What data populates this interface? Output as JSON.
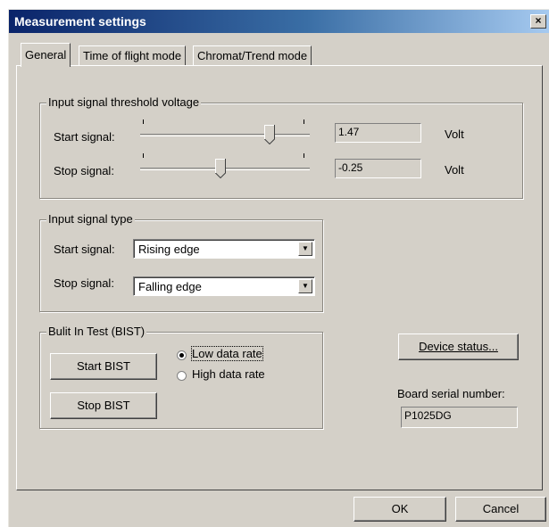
{
  "window": {
    "title": "Measurement settings",
    "close_glyph": "×"
  },
  "tabs": [
    {
      "label": "General",
      "active": true
    },
    {
      "label": "Time of flight mode",
      "active": false
    },
    {
      "label": "Chromat/Trend mode",
      "active": false
    }
  ],
  "threshold": {
    "legend": "Input signal threshold voltage",
    "start": {
      "label": "Start signal:",
      "value": "1.47",
      "unit": "Volt",
      "level": 0.78
    },
    "stop": {
      "label": "Stop signal:",
      "value": "-0.25",
      "unit": "Volt",
      "level": 0.47
    }
  },
  "signal_type": {
    "legend": "Input signal type",
    "start": {
      "label": "Start signal:",
      "value": "Rising edge"
    },
    "stop": {
      "label": "Stop signal:",
      "value": "Falling edge"
    }
  },
  "bist": {
    "legend": "Bulit In Test (BIST)",
    "start_button": "Start BIST",
    "stop_button": "Stop BIST",
    "low_rate": "Low data rate",
    "high_rate": "High data rate",
    "selected": "low"
  },
  "device": {
    "status_button": "Device status...",
    "serial_label": "Board serial number:",
    "serial_value": "P1025DG"
  },
  "footer": {
    "ok": "OK",
    "cancel": "Cancel"
  },
  "icons": {
    "dropdown": "triangle-down",
    "close": "x"
  }
}
